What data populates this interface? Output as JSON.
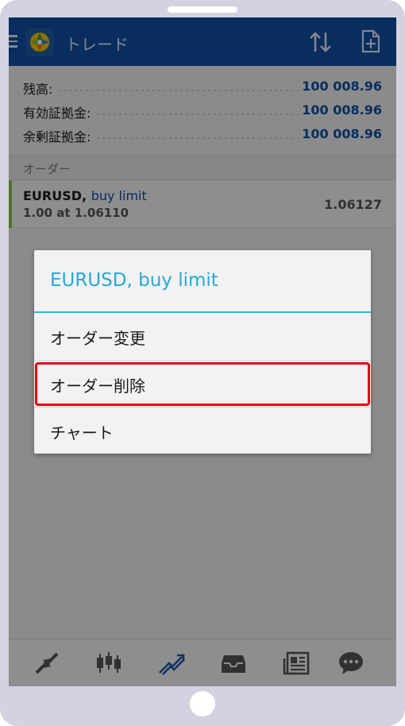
{
  "app": {
    "title": "トレード"
  },
  "account": {
    "rows": [
      {
        "label": "残高:",
        "value": "100 008.96"
      },
      {
        "label": "有効証拠金:",
        "value": "100 008.96"
      },
      {
        "label": "余剰証拠金:",
        "value": "100 008.96"
      }
    ]
  },
  "orders": {
    "section_label": "オーダー",
    "items": [
      {
        "symbol": "EURUSD,",
        "type": "buy limit",
        "detail": "1.00 at 1.06110",
        "current_price": "1.06127"
      }
    ]
  },
  "dialog": {
    "title": "EURUSD, buy limit",
    "items": [
      {
        "label": "オーダー変更"
      },
      {
        "label": "オーダー削除",
        "highlighted": true
      },
      {
        "label": "チャート"
      }
    ]
  },
  "bottom_nav": {
    "icons": [
      "quotes-icon",
      "chart-icon",
      "trade-icon",
      "history-icon",
      "news-icon",
      "chat-icon"
    ],
    "active": "trade-icon"
  },
  "colors": {
    "appbar": "#0f4fa3",
    "accent_blue": "#27a9d6",
    "highlight_red": "#e60012",
    "order_accent": "#8cc63f"
  }
}
